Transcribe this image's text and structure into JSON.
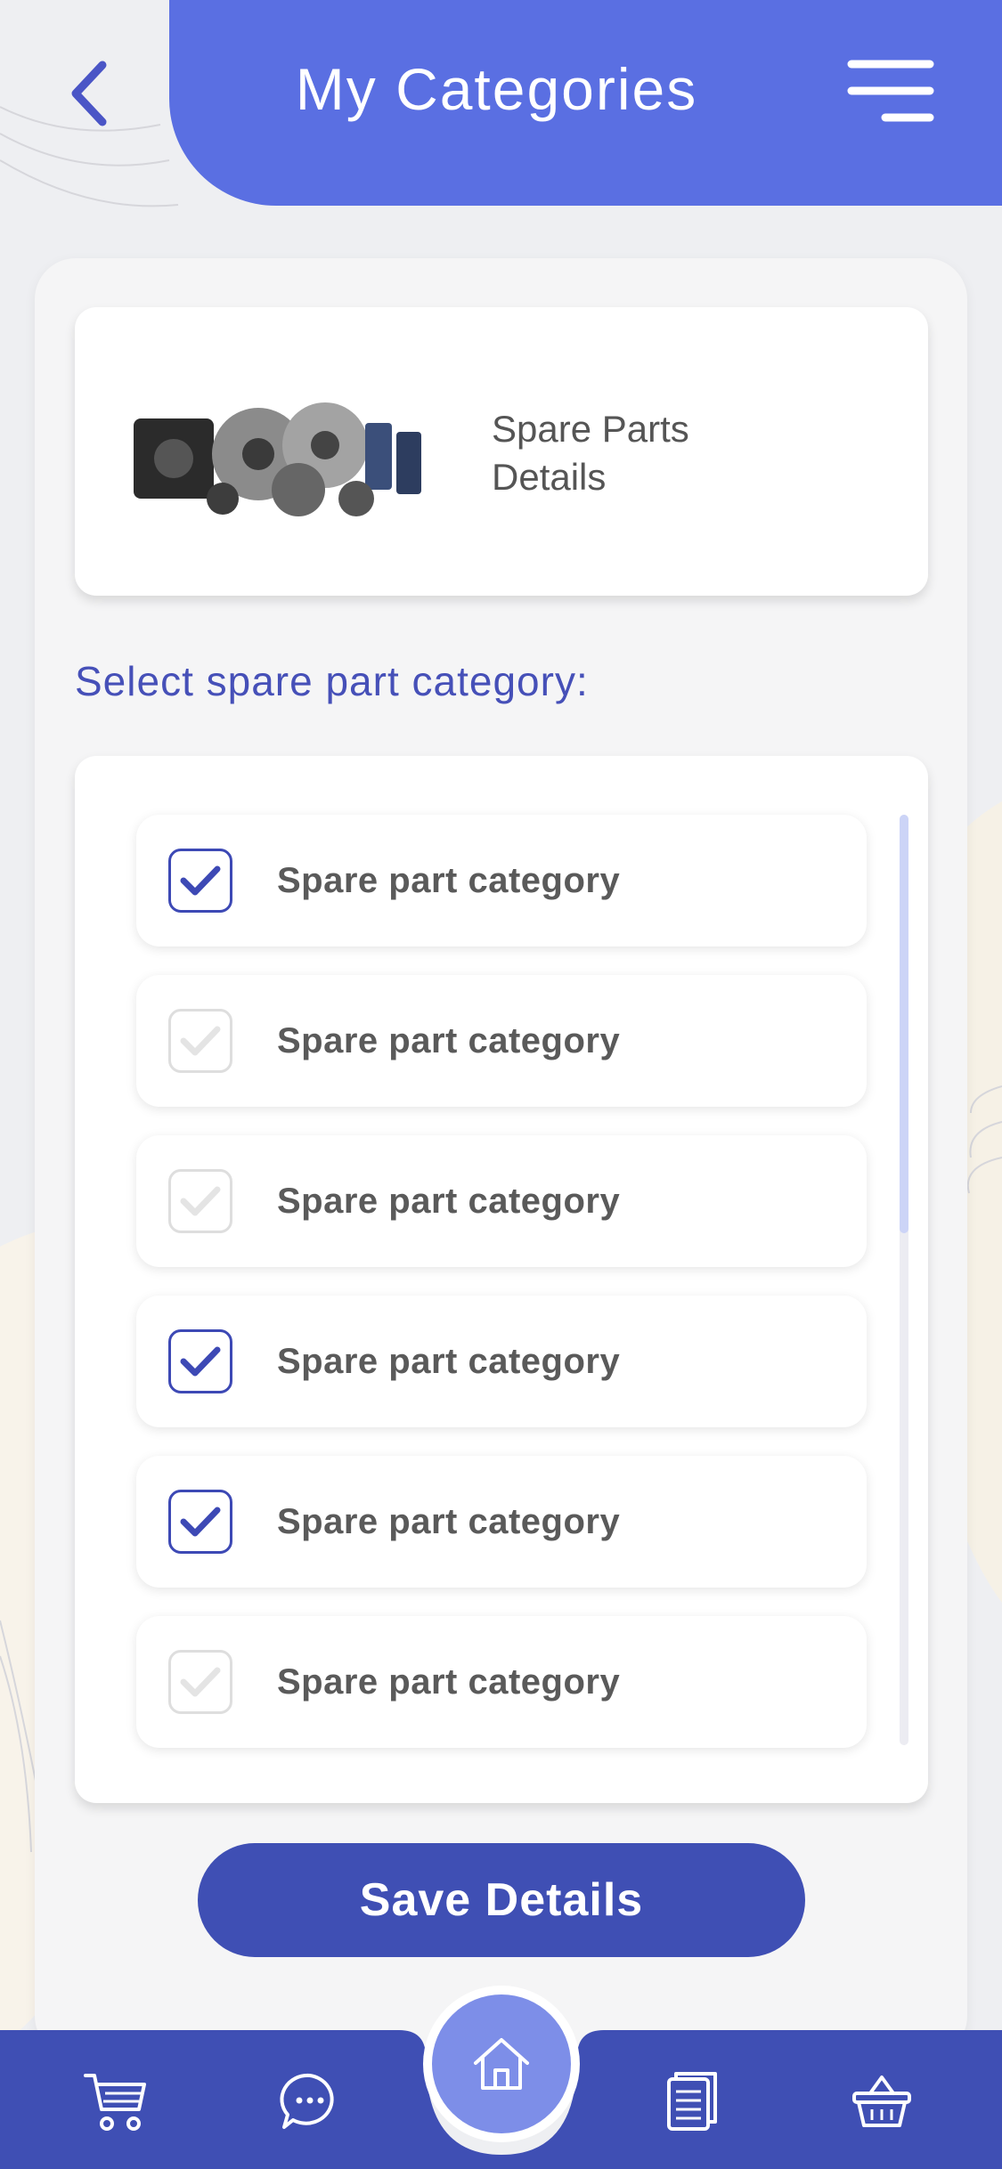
{
  "header": {
    "title": "My Categories"
  },
  "product": {
    "title": "Spare Parts\nDetails"
  },
  "section_label": "Select spare part category:",
  "categories": [
    {
      "label": "Spare part category",
      "checked": true
    },
    {
      "label": "Spare part category",
      "checked": false
    },
    {
      "label": "Spare part category",
      "checked": false
    },
    {
      "label": "Spare part category",
      "checked": true
    },
    {
      "label": "Spare part category",
      "checked": true
    },
    {
      "label": "Spare part category",
      "checked": false
    }
  ],
  "save_button": {
    "label": "Save Details"
  },
  "colors": {
    "header": "#5a6fe2",
    "accent": "#3f4fb4",
    "label": "#4650b8",
    "nav": "#3f4fb4"
  },
  "icons": [
    "back-arrow-icon",
    "menu-icon",
    "cart-icon",
    "chat-icon",
    "home-icon",
    "document-icon",
    "basket-icon"
  ]
}
